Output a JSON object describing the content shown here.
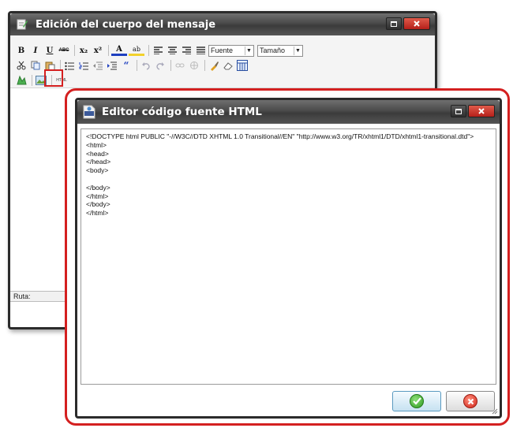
{
  "back_window": {
    "title": "Edición del cuerpo del mensaje",
    "toolbar": {
      "bold_label": "B",
      "italic_label": "I",
      "underline_label": "U",
      "strike_label": "ABC",
      "subscript_label": "x₂",
      "superscript_label": "x²",
      "font_color_label": "A",
      "highlight_label": "ab",
      "font_select": "Fuente",
      "size_select": "Tamaño",
      "html_button_label": "HTML"
    },
    "path_label": "Ruta:"
  },
  "front_window": {
    "title": "Editor código fuente HTML",
    "code_lines": [
      "<!DOCTYPE html PUBLIC \"-//W3C//DTD XHTML 1.0 Transitional//EN\" \"http://www.w3.org/TR/xhtml1/DTD/xhtml1-transitional.dtd\">",
      "<html>",
      "<head>",
      "</head>",
      "<body>",
      "",
      "</body>",
      "</html>",
      "</body>",
      "</html>"
    ]
  },
  "colors": {
    "highlight_red": "#d42020",
    "titlebar_dark": "#3b3b3b",
    "close_red": "#c9332a",
    "ok_green": "#2f9b22",
    "cancel_red": "#d0261a"
  }
}
